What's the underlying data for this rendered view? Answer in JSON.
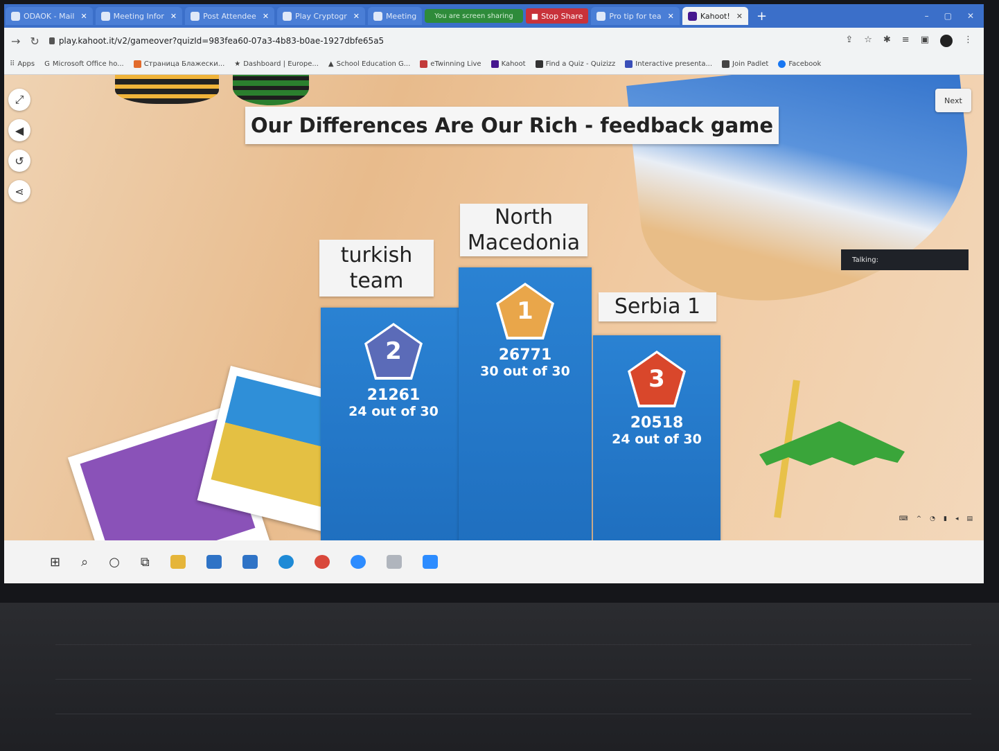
{
  "browser": {
    "tabs": [
      {
        "label": "ODAOK - Mail",
        "active": false
      },
      {
        "label": "Meeting Infor",
        "active": false
      },
      {
        "label": "Post Attendee",
        "active": false
      },
      {
        "label": "Play Cryptogr",
        "active": false
      },
      {
        "label": "Meeting",
        "active": false
      },
      {
        "label": "Pro tip for tea",
        "active": false
      },
      {
        "label": "Kahoot!",
        "active": true
      }
    ],
    "share_banner": "You are screen sharing",
    "stop_share": "Stop Share",
    "url": "play.kahoot.it/v2/gameover?quizId=983fea60-07a3-4b83-b0ae-1927dbfe65a5",
    "bookmarks": [
      "Apps",
      "Microsoft Office ho...",
      "Страница Блажески...",
      "Dashboard | Europe...",
      "School Education G...",
      "eTwinning Live",
      "Kahoot",
      "Find a Quiz - Quizizz",
      "Interactive presenta...",
      "Join Padlet",
      "Facebook"
    ]
  },
  "game": {
    "title": "Our Differences Are Our Rich - feedback game",
    "next_label": "Next",
    "talking_label": "Talking:",
    "podium": [
      {
        "rank": "2",
        "team": "turkish team",
        "score": "21261",
        "correct": "24 out of 30",
        "badge_color": "#5b6bb8"
      },
      {
        "rank": "1",
        "team": "North Macedonia",
        "score": "26771",
        "correct": "30 out of 30",
        "badge_color": "#e9a64a"
      },
      {
        "rank": "3",
        "team": "Serbia 1",
        "score": "20518",
        "correct": "24 out of 30",
        "badge_color": "#d9472b"
      }
    ]
  },
  "colors": {
    "podium_blue": "#2a82d3",
    "title_bg": "#f6f6f6",
    "tab_blue": "#3b6fc9"
  }
}
